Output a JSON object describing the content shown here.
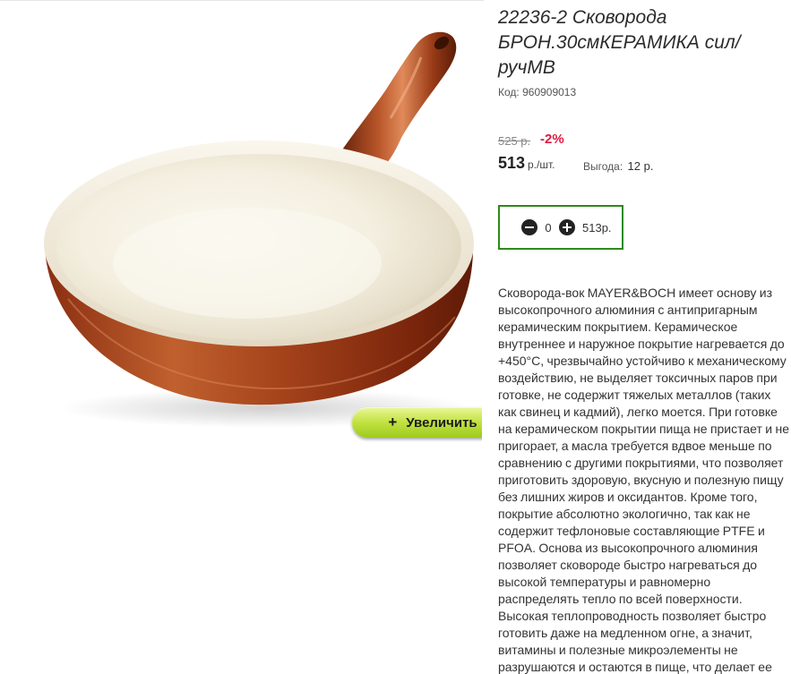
{
  "product": {
    "title": "22236-2 Сковорода БРОН.30смКЕРАМИКА сил/ручМВ",
    "code_label": "Код:",
    "code_value": "960909013",
    "old_price": "525 р.",
    "discount": "-2%",
    "price": "513",
    "price_unit": "р./шт.",
    "benefit_label": "Выгода:",
    "benefit_value": "12 р.",
    "image_icon": "frying-pan-image"
  },
  "cart": {
    "quantity": "0",
    "sum": "513р.",
    "minus_icon": "minus-circle-icon",
    "plus_icon": "plus-circle-icon",
    "border_color": "#2e8a1a"
  },
  "zoom": {
    "plus": "+",
    "label": "Увеличить",
    "color": "#b5dc35"
  },
  "description": "Сковорода-вок MAYER&BOCH имеет основу из высокопрочного алюминия с антипригарным керамическим покрытием. Керамическое внутреннее и наружное покрытие нагревается до +450°С, чрезвычайно устойчиво к механическому воздействию, не выделяет токсичных паров при готовке, не содержит тяжелых металлов (таких как свинец и кадмий), легко моется. При готовке на керамическом покрытии пища не пристает и не пригорает, а масла требуется вдвое меньше по сравнению с другими покрытиями, что позволяет приготовить здоровую, вкусную и полезную пищу без лишних жиров и оксидантов. Кроме того, покрытие абсолютно экологично, так как не содержит тефлоновые составляющие PTFE и PFOA. Основа из высокопрочного алюминия позволяет сковороде быстро нагреваться до высокой температуры и равномерно распределять тепло по всей поверхности. Высокая теплопроводность позволяет быстро готовить даже на медленном огне, а значит, витамины и полезные микроэлементы не разрушаются и остаются в пище, что делает ее здоровой и",
  "colors": {
    "discount": "#e0183f",
    "pan_copper": "#9a3b17",
    "pan_ceramic": "#f3efe2"
  }
}
